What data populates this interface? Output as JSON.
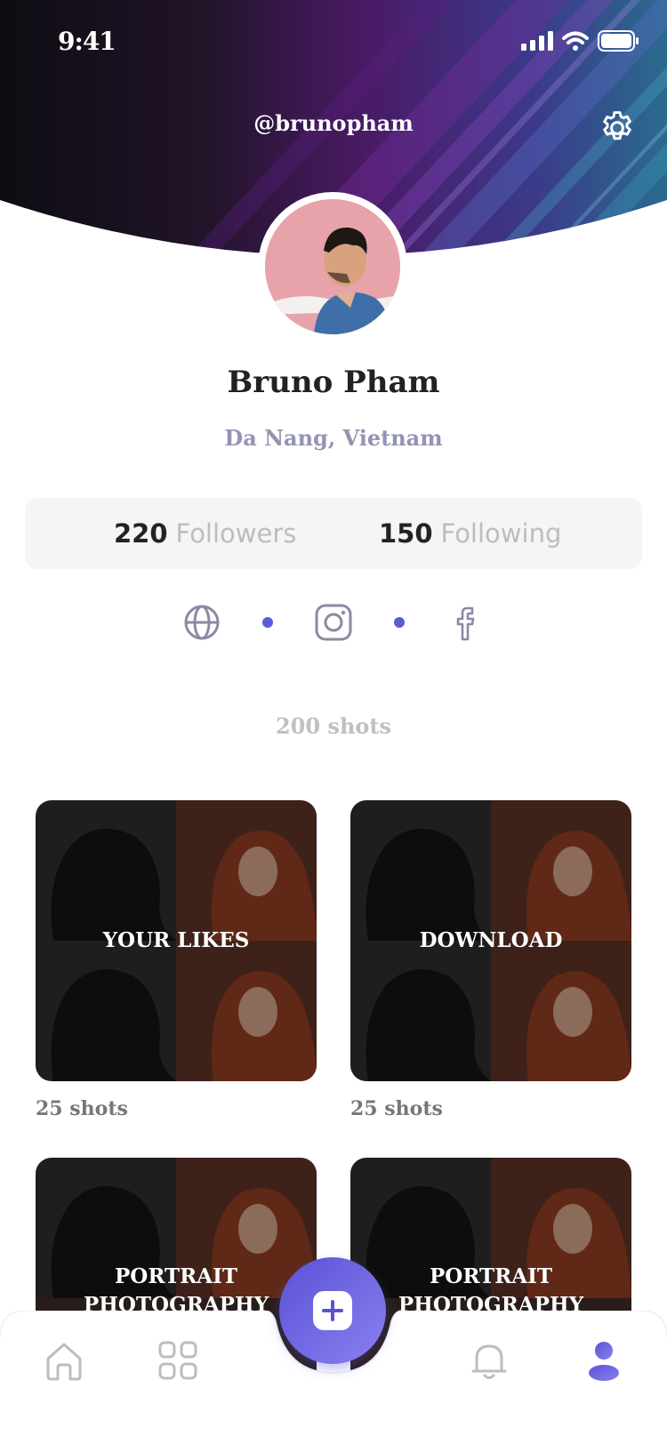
{
  "status_bar": {
    "time": "9:41"
  },
  "header": {
    "username": "@brunopham"
  },
  "profile": {
    "name": "Bruno Pham",
    "location": "Da Nang, Vietnam"
  },
  "stats": {
    "followers_count": "220",
    "followers_label": "Followers",
    "following_count": "150",
    "following_label": "Following"
  },
  "social_links": [
    "globe-icon",
    "instagram-icon",
    "facebook-icon"
  ],
  "shots_total": "200 shots",
  "collections": [
    {
      "title": "YOUR LIKES",
      "count": "25 shots"
    },
    {
      "title": "DOWNLOAD",
      "count": "25 shots"
    },
    {
      "title": "PORTRAIT PHOTOGRAPHY",
      "count": ""
    },
    {
      "title": "PORTRAIT PHOTOGRAPHY",
      "count": ""
    }
  ],
  "tab_bar": {
    "items": [
      "home-icon",
      "grid-icon",
      "add-icon",
      "bell-icon",
      "profile-icon"
    ],
    "active": "profile-icon"
  },
  "colors": {
    "accent": "#5b5bd6",
    "header_dark": "#141018",
    "header_purple": "#5a1f78",
    "header_blue": "#2f5f8a",
    "location_text": "#9393b3",
    "stats_bg": "#f4f5f6"
  }
}
